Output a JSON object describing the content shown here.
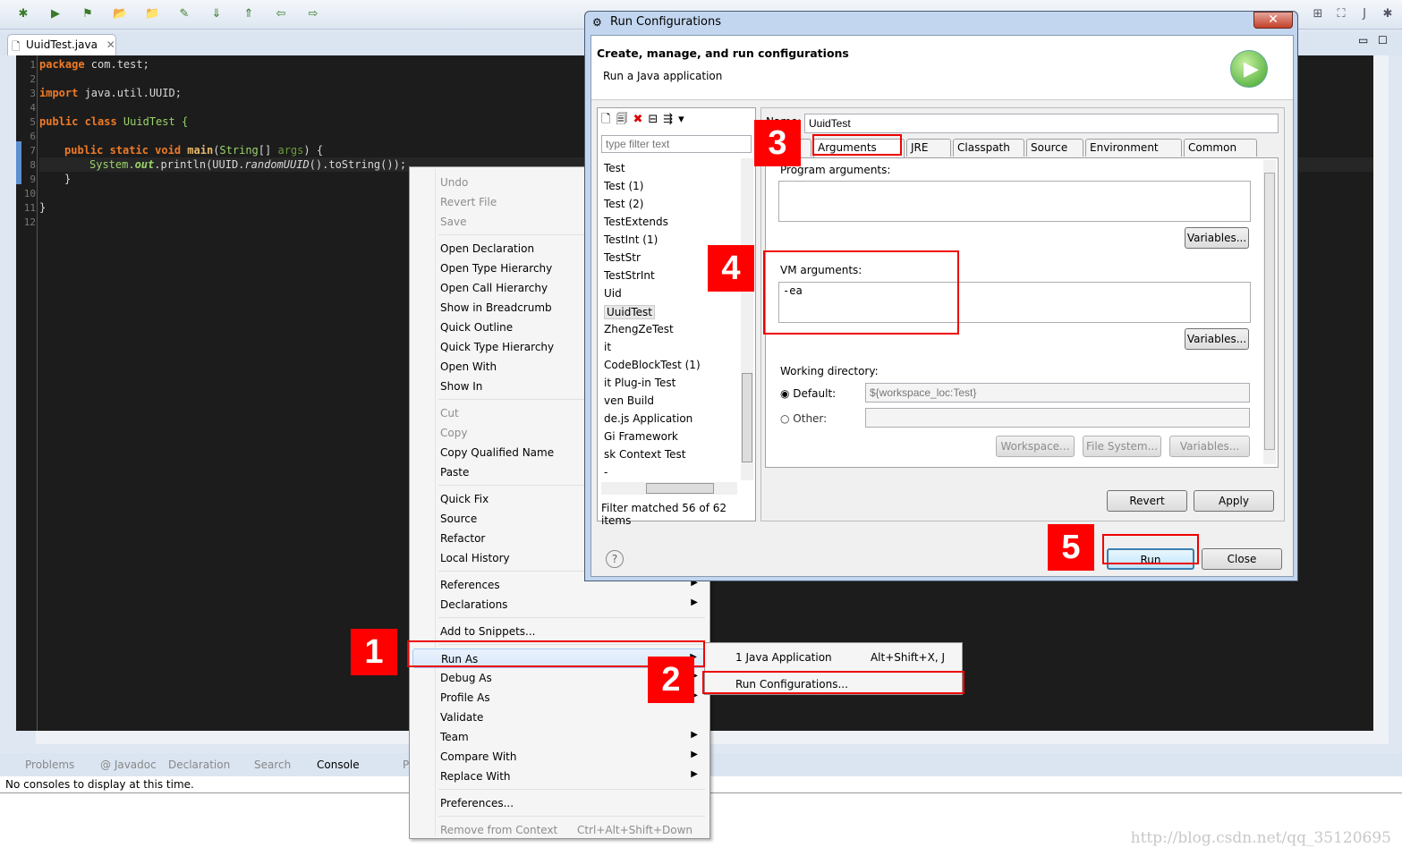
{
  "toolbar": {
    "icons": [
      "debug-icon",
      "run-icon",
      "external-tools-icon",
      "open-type-icon",
      "open-task-icon",
      "search-icon",
      "next-annotation-icon",
      "previous-annotation-icon",
      "back-icon",
      "forward-icon"
    ],
    "right_icons": [
      "open-perspective-icon",
      "hierarchy-perspective-icon",
      "java-perspective-icon",
      "debug-perspective-icon"
    ]
  },
  "editor": {
    "tab": "UuidTest.java",
    "line_numbers": [
      "1",
      "2",
      "3",
      "4",
      "5",
      "6",
      "7",
      "8",
      "9",
      "10",
      "11",
      "12"
    ]
  },
  "code": {
    "l1a": "package",
    "l1b": " com.test;",
    "l3a": "import",
    "l3b": " java.util.UUID;",
    "l5a": "public class",
    "l5b": " UuidTest {",
    "l7a": "public static void",
    "l7b": "main",
    "l7c": "(",
    "l7d": "String",
    "l7e": "[] ",
    "l7f": "args",
    "l7g": ") {",
    "l8a": "System.",
    "l8b": "out",
    "l8c": ".println(UUID.",
    "l8d": "randomUUID",
    "l8e": "().toString());",
    "l9": "}",
    "l11": "}"
  },
  "bottom_panel": {
    "tabs": [
      "Problems",
      "@ Javadoc",
      "Declaration",
      "Search",
      "Console",
      "P"
    ],
    "active": "Console",
    "message": "No consoles to display at this time."
  },
  "context_menu": {
    "items": [
      {
        "label": "Undo",
        "disabled": true
      },
      {
        "label": "Revert File",
        "disabled": true
      },
      {
        "label": "Save",
        "disabled": true
      },
      {
        "sep": true
      },
      {
        "label": "Open Declaration"
      },
      {
        "label": "Open Type Hierarchy"
      },
      {
        "label": "Open Call Hierarchy"
      },
      {
        "label": "Show in Breadcrumb"
      },
      {
        "label": "Quick Outline"
      },
      {
        "label": "Quick Type Hierarchy"
      },
      {
        "label": "Open With",
        "sub": true
      },
      {
        "label": "Show In",
        "sub": true
      },
      {
        "sep": true
      },
      {
        "label": "Cut",
        "disabled": true
      },
      {
        "label": "Copy",
        "disabled": true
      },
      {
        "label": "Copy Qualified Name"
      },
      {
        "label": "Paste"
      },
      {
        "sep": true
      },
      {
        "label": "Quick Fix"
      },
      {
        "label": "Source",
        "sub": true
      },
      {
        "label": "Refactor",
        "sub": true
      },
      {
        "label": "Local History",
        "sub": true
      },
      {
        "sep": true
      },
      {
        "label": "References",
        "sub": true
      },
      {
        "label": "Declarations",
        "sub": true
      },
      {
        "sep": true
      },
      {
        "label": "Add to Snippets..."
      },
      {
        "sep": true
      },
      {
        "label": "Run As",
        "sub": true,
        "selected": true
      },
      {
        "label": "Debug As",
        "sub": true
      },
      {
        "label": "Profile As",
        "sub": true
      },
      {
        "label": "Validate"
      },
      {
        "label": "Team",
        "sub": true
      },
      {
        "label": "Compare With",
        "sub": true
      },
      {
        "label": "Replace With",
        "sub": true
      },
      {
        "sep": true
      },
      {
        "label": "Preferences..."
      },
      {
        "sep": true
      },
      {
        "label": "Remove from Context",
        "shortcut": "Ctrl+Alt+Shift+Down",
        "disabled": true
      }
    ]
  },
  "submenu": {
    "items": [
      {
        "label": "1 Java Application",
        "shortcut": "Alt+Shift+X, J"
      },
      {
        "label": "Run Configurations..."
      }
    ]
  },
  "dialog": {
    "title": "Run Configurations",
    "close": "✕",
    "header_title": "Create, manage, and run configurations",
    "header_subtitle": "Run a Java application",
    "filter_placeholder": "type filter text",
    "list": [
      "Test",
      "Test (1)",
      "Test (2)",
      "TestExtends",
      "TestInt (1)",
      "TestStr",
      "TestStrInt",
      "Uid",
      "UuidTest",
      "ZhengZeTest",
      "it",
      "CodeBlockTest (1)",
      "it Plug-in Test",
      "ven Build",
      "de.js Application",
      "Gi Framework",
      "sk Context Test",
      "-"
    ],
    "selected": "UuidTest",
    "filter_status": "Filter matched 56 of 62 items",
    "name_label": "Name:",
    "name_value": "UuidTest",
    "tabs": [
      "ain",
      "Arguments",
      "JRE",
      "Classpath",
      "Source",
      "Environment",
      "Common"
    ],
    "active_tab": "Arguments",
    "program_args_label": "Program arguments:",
    "program_args": "",
    "variables": "Variables...",
    "vm_args_label": "VM arguments:",
    "vm_args": "-ea",
    "working_dir_label": "Working directory:",
    "default_label": "Default:",
    "default_value": "${workspace_loc:Test}",
    "other_label": "Other:",
    "other_value": "",
    "workspace_btn": "Workspace...",
    "filesystem_btn": "File System...",
    "revert": "Revert",
    "apply": "Apply",
    "run": "Run",
    "close_btn": "Close",
    "help": "?"
  },
  "annotations": [
    "1",
    "2",
    "3",
    "4",
    "5"
  ],
  "annotation_color": "#ff0000",
  "watermark": "http://blog.csdn.net/qq_35120695"
}
